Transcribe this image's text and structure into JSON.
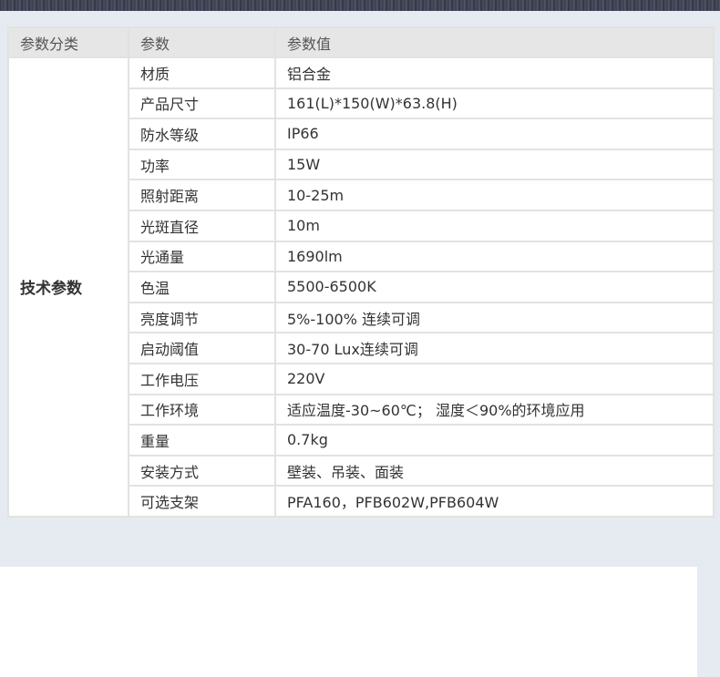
{
  "table": {
    "headers": {
      "category": "参数分类",
      "parameter": "参数",
      "value": "参数值"
    },
    "category_label": "技术参数",
    "rows": [
      {
        "param": "材质",
        "value": "铝合金"
      },
      {
        "param": "产品尺寸",
        "value": "161(L)*150(W)*63.8(H)"
      },
      {
        "param": "防水等级",
        "value": "IP66"
      },
      {
        "param": "功率",
        "value": "15W"
      },
      {
        "param": "照射距离",
        "value": "10-25m"
      },
      {
        "param": "光斑直径",
        "value": "10m"
      },
      {
        "param": "光通量",
        "value": "1690lm"
      },
      {
        "param": "色温",
        "value": "5500-6500K"
      },
      {
        "param": "亮度调节",
        "value": "5%-100% 连续可调"
      },
      {
        "param": "启动阈值",
        "value": "30-70 Lux连续可调"
      },
      {
        "param": "工作电压",
        "value": "220V"
      },
      {
        "param": "工作环境",
        "value": "适应温度-30~60℃； 湿度＜90%的环境应用"
      },
      {
        "param": "重量",
        "value": "0.7kg"
      },
      {
        "param": "安装方式",
        "value": "壁装、吊装、面装"
      },
      {
        "param": "可选支架",
        "value": "PFA160，PFB602W,PFB604W"
      }
    ]
  },
  "colors": {
    "page_background": "#e5ebf0",
    "header_background": "#e6e6e6",
    "border": "#e2e2e2"
  }
}
